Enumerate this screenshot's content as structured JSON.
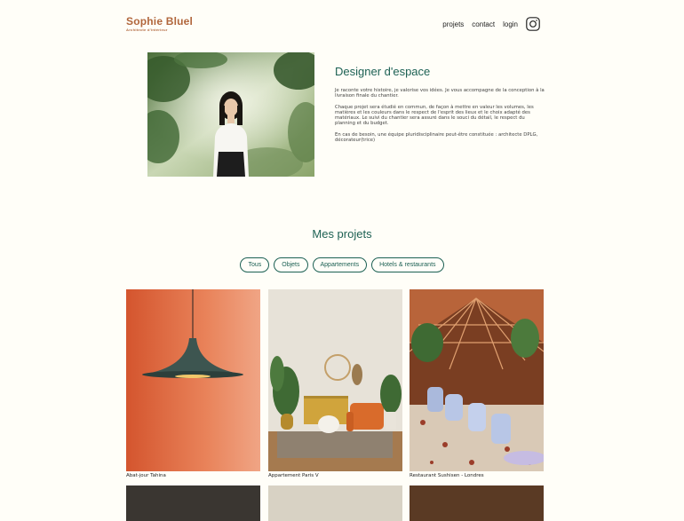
{
  "header": {
    "logo_name": "Sophie Bluel",
    "logo_subtitle": "Architecte d'intérieur",
    "nav": [
      "projets",
      "contact",
      "login"
    ],
    "instagram_icon": "instagram-icon"
  },
  "intro": {
    "title": "Designer d'espace",
    "paragraphs": [
      "Je raconte votre histoire, je valorise vos idées. Je vous accompagne de la conception à la livraison finale du chantier.",
      "Chaque projet sera étudié en commun, de façon à mettre en valeur les volumes, les matières et les couleurs dans le respect de l'esprit des lieux et le choix adapté des matériaux. Le suivi du chantier sera assuré dans le souci du détail, le respect du planning et du budget.",
      "En cas de besoin, une équipe pluridisciplinaire peut-être constituée : architecte DPLG, décorateur(trice)"
    ]
  },
  "projects": {
    "title": "Mes projets",
    "filters": [
      "Tous",
      "Objets",
      "Appartements",
      "Hotels & restaurants"
    ],
    "items": [
      {
        "caption": "Abat-jour Tahina"
      },
      {
        "caption": "Appartement Paris V"
      },
      {
        "caption": "Restaurant Sushisen - Londres"
      }
    ]
  },
  "colors": {
    "brand": "#b1663c",
    "accent": "#1d6154",
    "background": "#fffef8"
  }
}
